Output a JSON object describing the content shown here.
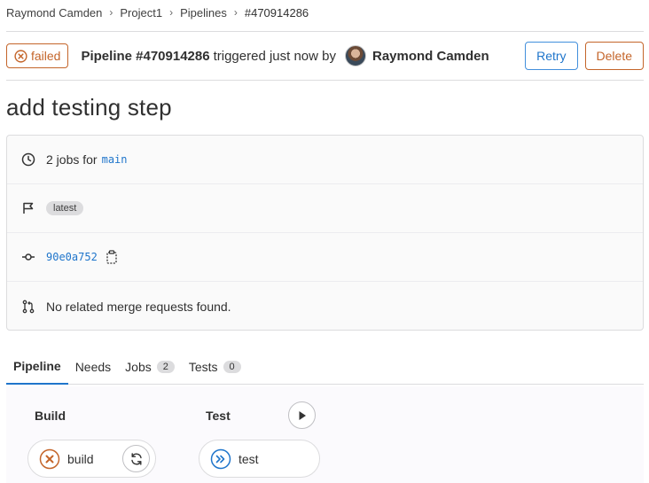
{
  "breadcrumb": [
    "Raymond Camden",
    "Project1",
    "Pipelines",
    "#470914286"
  ],
  "header": {
    "status": "failed",
    "pipeline_label": "Pipeline #470914286",
    "triggered_text": "triggered just now by",
    "author": "Raymond Camden",
    "retry_label": "Retry",
    "delete_label": "Delete"
  },
  "title": "add testing step",
  "info": {
    "jobs_prefix": "2 jobs for",
    "branch": "main",
    "tag": "latest",
    "commit_sha": "90e0a752",
    "merge_requests": "No related merge requests found."
  },
  "tabs": [
    {
      "label": "Pipeline",
      "count": ""
    },
    {
      "label": "Needs",
      "count": ""
    },
    {
      "label": "Jobs",
      "count": "2"
    },
    {
      "label": "Tests",
      "count": "0"
    }
  ],
  "stages": [
    {
      "name": "Build",
      "job": "build",
      "job_status": "failed"
    },
    {
      "name": "Test",
      "job": "test",
      "job_status": "skipped"
    }
  ],
  "colors": {
    "failed": "#c4652a",
    "link": "#1f75cb",
    "skipped": "#1f75cb"
  },
  "icons": {
    "status_failed": "failed-x-icon",
    "clock": "clock-icon",
    "flag": "flag-icon",
    "commit": "commit-icon",
    "copy": "copy-icon",
    "merge_request": "merge-request-icon",
    "retry": "retry-icon",
    "play": "play-icon",
    "skipped": "skipped-icon"
  }
}
